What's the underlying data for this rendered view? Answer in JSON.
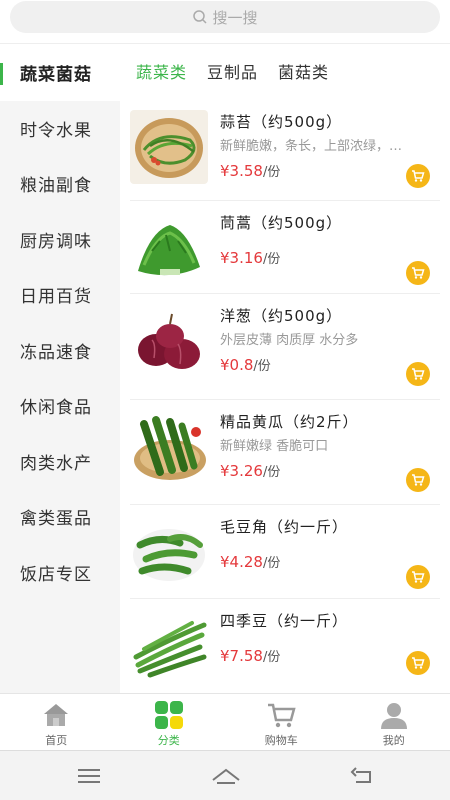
{
  "search": {
    "placeholder": "搜一搜"
  },
  "sidebar": {
    "items": [
      {
        "label": "蔬菜菌菇"
      },
      {
        "label": "时令水果"
      },
      {
        "label": "粮油副食"
      },
      {
        "label": "厨房调味"
      },
      {
        "label": "日用百货"
      },
      {
        "label": "冻品速食"
      },
      {
        "label": "休闲食品"
      },
      {
        "label": "肉类水产"
      },
      {
        "label": "禽类蛋品"
      },
      {
        "label": "饭店专区"
      }
    ]
  },
  "tabs": [
    {
      "label": "蔬菜类"
    },
    {
      "label": "豆制品"
    },
    {
      "label": "菌菇类"
    }
  ],
  "products": [
    {
      "name": "蒜苔（约500g）",
      "desc": "新鲜脆嫩，条长，上部浓绿，…",
      "price": "¥3.58",
      "unit": "/份"
    },
    {
      "name": "茼蒿（约500g）",
      "desc": "",
      "price": "¥3.16",
      "unit": "/份"
    },
    {
      "name": "洋葱（约500g）",
      "desc": "外层皮薄 肉质厚 水分多",
      "price": "¥0.8",
      "unit": "/份"
    },
    {
      "name": "精品黄瓜（约2斤）",
      "desc": "新鲜嫩绿 香脆可口",
      "price": "¥3.26",
      "unit": "/份"
    },
    {
      "name": "毛豆角（约一斤）",
      "desc": "",
      "price": "¥4.28",
      "unit": "/份"
    },
    {
      "name": "四季豆（约一斤）",
      "desc": "",
      "price": "¥7.58",
      "unit": "/份"
    }
  ],
  "bottom_nav": {
    "home": "首页",
    "category": "分类",
    "cart": "购物车",
    "mine": "我的"
  },
  "colors": {
    "accent": "#3cb54a",
    "price": "#e4393c",
    "cart_button": "#f5b617"
  }
}
